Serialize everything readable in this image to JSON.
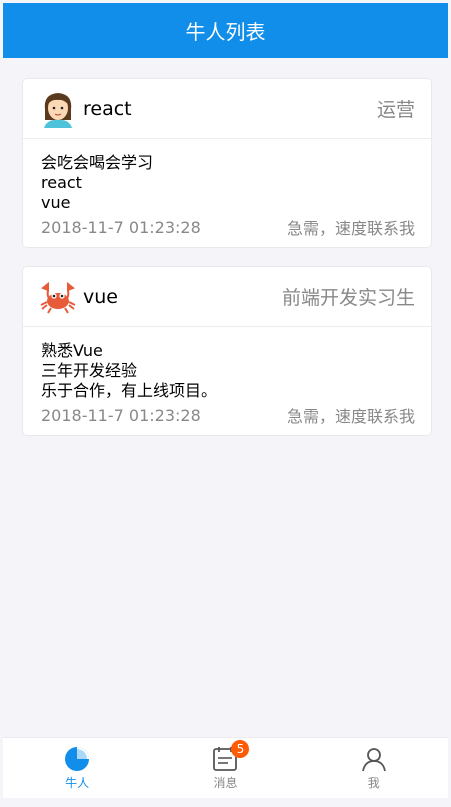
{
  "navbar": {
    "title": "牛人列表"
  },
  "cards": [
    {
      "user": "react",
      "avatar_icon": "girl-avatar-icon",
      "title": "运营",
      "desc": [
        "会吃会喝会学习",
        "react",
        "vue"
      ],
      "time": "2018-11-7 01:23:28",
      "note": "急需，速度联系我"
    },
    {
      "user": "vue",
      "avatar_icon": "crab-avatar-icon",
      "title": "前端开发实习生",
      "desc": [
        "熟悉Vue",
        "三年开发经验",
        "乐于合作，有上线项目。"
      ],
      "time": "2018-11-7 01:23:28",
      "note": "急需，速度联系我"
    }
  ],
  "tabbar": {
    "items": [
      {
        "label": "牛人",
        "icon": "genius-icon",
        "active": true
      },
      {
        "label": "消息",
        "icon": "message-icon",
        "badge": "5"
      },
      {
        "label": "我",
        "icon": "user-icon"
      }
    ]
  },
  "colors": {
    "primary": "#108ee9",
    "badge": "#ff5b05",
    "muted": "#888888"
  }
}
